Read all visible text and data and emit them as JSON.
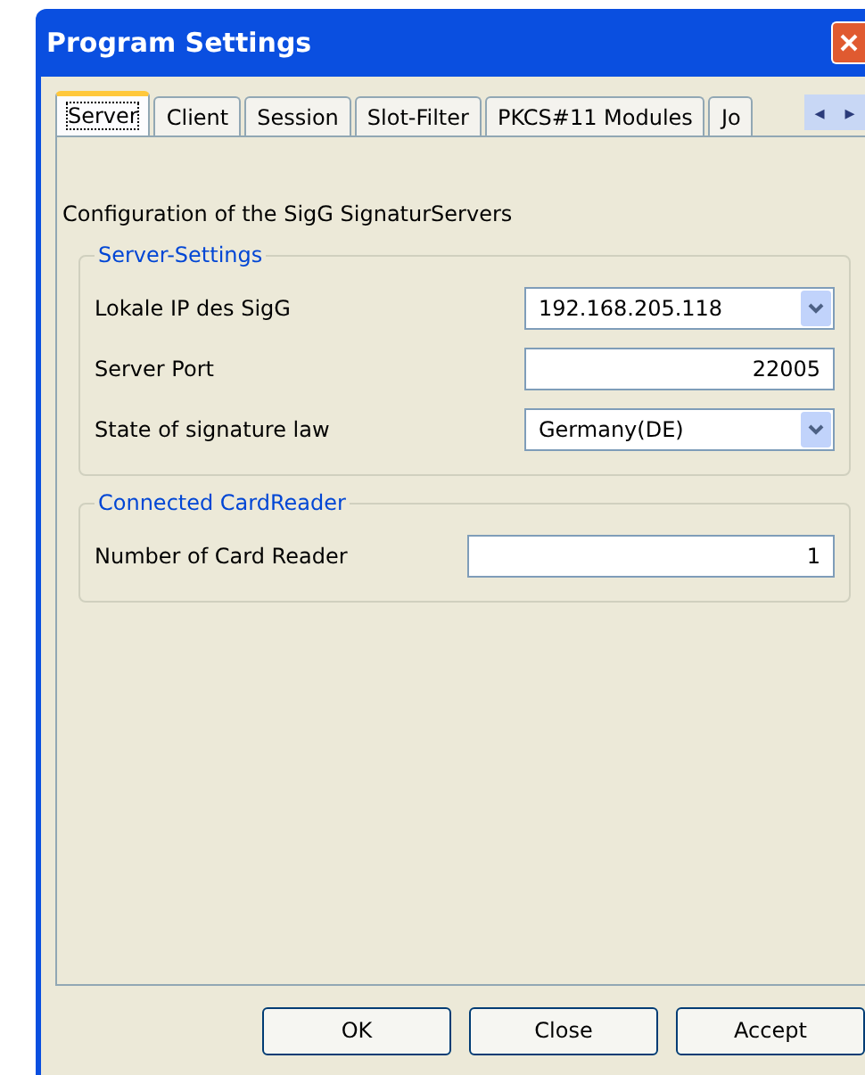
{
  "window": {
    "title": "Program Settings"
  },
  "tabs": [
    {
      "label": "Server",
      "selected": true
    },
    {
      "label": "Client",
      "selected": false
    },
    {
      "label": "Session",
      "selected": false
    },
    {
      "label": "Slot-Filter",
      "selected": false
    },
    {
      "label": "PKCS#11 Modules",
      "selected": false
    },
    {
      "label": "Jo",
      "selected": false
    }
  ],
  "tab_scroll": [
    "◂",
    "▸"
  ],
  "description": "Configuration of the SigG SignaturServers",
  "groups": [
    {
      "title": "Server-Settings",
      "fields": [
        {
          "label": "Lokale IP des SigG",
          "kind": "combo",
          "value": "192.168.205.118"
        },
        {
          "label": "Server Port",
          "kind": "text",
          "value": "22005"
        },
        {
          "label": "State of signature law",
          "kind": "combo",
          "value": "Germany(DE)"
        }
      ]
    },
    {
      "title": "Connected CardReader",
      "fields": [
        {
          "label": "Number of Card Reader",
          "kind": "wide",
          "value": "1"
        }
      ]
    }
  ],
  "buttons": [
    "OK",
    "Close",
    "Accept"
  ]
}
